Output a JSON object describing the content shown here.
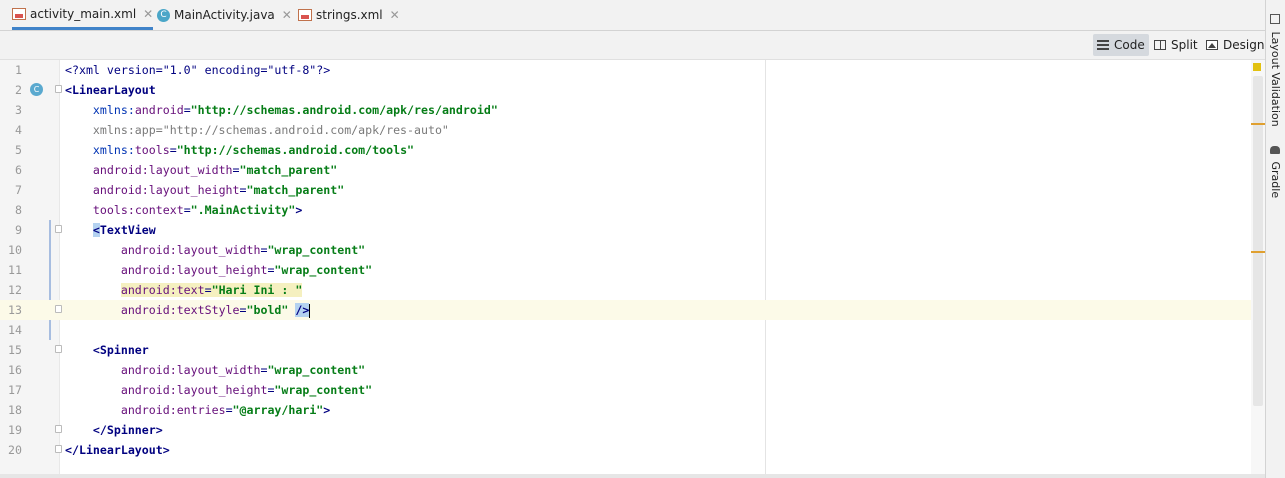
{
  "tabs": [
    {
      "label": "activity_main.xml",
      "icon": "xml-file-icon",
      "active": true
    },
    {
      "label": "MainActivity.java",
      "icon": "java-class-icon",
      "active": false
    },
    {
      "label": "strings.xml",
      "icon": "xml-file-icon",
      "active": false
    }
  ],
  "view_modes": [
    {
      "label": "Code",
      "icon": "code-view-icon",
      "selected": true
    },
    {
      "label": "Split",
      "icon": "split-view-icon",
      "selected": false
    },
    {
      "label": "Design",
      "icon": "design-view-icon",
      "selected": false
    }
  ],
  "right_panel": {
    "layout_validation": "Layout Validation",
    "gradle": "Gradle"
  },
  "gutter_badge": "C",
  "colors": {
    "tag": "#000080",
    "attribute": "#660e7a",
    "value": "#067d17",
    "current_line": "#fcfae8",
    "selection": "#b4d2f0",
    "active_tab_underline": "#4083c9"
  },
  "editor": {
    "lines": [
      {
        "n": "1",
        "indent": "",
        "tokens": [
          {
            "t": "<?xml version=\"1.0\" encoding=\"utf-8\"?>",
            "c": "tagb"
          }
        ]
      },
      {
        "n": "2",
        "indent": "",
        "tokens": [
          {
            "t": "<LinearLayout",
            "c": "tag"
          }
        ]
      },
      {
        "n": "3",
        "indent": "    ",
        "tokens": [
          {
            "t": "xmlns:",
            "c": "ns"
          },
          {
            "t": "android",
            "c": "attr"
          },
          {
            "t": "=",
            "c": "tagb"
          },
          {
            "t": "\"http://schemas.android.com/apk/res/android\"",
            "c": "val"
          }
        ]
      },
      {
        "n": "4",
        "indent": "    ",
        "tokens": [
          {
            "t": "xmlns:app=\"http://schemas.android.com/apk/res-auto\"",
            "c": "gray"
          }
        ]
      },
      {
        "n": "5",
        "indent": "    ",
        "tokens": [
          {
            "t": "xmlns:",
            "c": "ns"
          },
          {
            "t": "tools",
            "c": "attr"
          },
          {
            "t": "=",
            "c": "tagb"
          },
          {
            "t": "\"http://schemas.android.com/tools\"",
            "c": "val"
          }
        ]
      },
      {
        "n": "6",
        "indent": "    ",
        "tokens": [
          {
            "t": "android:",
            "c": "attr"
          },
          {
            "t": "layout_width",
            "c": "attr"
          },
          {
            "t": "=",
            "c": "tagb"
          },
          {
            "t": "\"match_parent\"",
            "c": "val"
          }
        ]
      },
      {
        "n": "7",
        "indent": "    ",
        "tokens": [
          {
            "t": "android:",
            "c": "attr"
          },
          {
            "t": "layout_height",
            "c": "attr"
          },
          {
            "t": "=",
            "c": "tagb"
          },
          {
            "t": "\"match_parent\"",
            "c": "val"
          }
        ]
      },
      {
        "n": "8",
        "indent": "    ",
        "tokens": [
          {
            "t": "tools:",
            "c": "attr"
          },
          {
            "t": "context",
            "c": "attr"
          },
          {
            "t": "=",
            "c": "tagb"
          },
          {
            "t": "\".MainActivity\"",
            "c": "val"
          },
          {
            "t": ">",
            "c": "tag"
          }
        ]
      },
      {
        "n": "9",
        "indent": "    ",
        "tokens": [
          {
            "t": "<",
            "c": "tag sel-bg"
          },
          {
            "t": "TextView",
            "c": "tag"
          }
        ]
      },
      {
        "n": "10",
        "indent": "        ",
        "tokens": [
          {
            "t": "android:",
            "c": "attr"
          },
          {
            "t": "layout_width",
            "c": "attr"
          },
          {
            "t": "=",
            "c": "tagb"
          },
          {
            "t": "\"wrap_content\"",
            "c": "val"
          }
        ]
      },
      {
        "n": "11",
        "indent": "        ",
        "tokens": [
          {
            "t": "android:",
            "c": "attr"
          },
          {
            "t": "layout_height",
            "c": "attr"
          },
          {
            "t": "=",
            "c": "tagb"
          },
          {
            "t": "\"wrap_content\"",
            "c": "val"
          }
        ]
      },
      {
        "n": "12",
        "indent": "        ",
        "tokens": [
          {
            "t": "android:",
            "c": "attr hl-attr"
          },
          {
            "t": "text",
            "c": "attr hl-attr"
          },
          {
            "t": "=",
            "c": "tagb hl-attr"
          },
          {
            "t": "\"Hari Ini : \"",
            "c": "val hl-attr"
          }
        ]
      },
      {
        "n": "13",
        "indent": "        ",
        "tokens": [
          {
            "t": "android:",
            "c": "attr"
          },
          {
            "t": "textStyle",
            "c": "attr"
          },
          {
            "t": "=",
            "c": "tagb"
          },
          {
            "t": "\"bold\"",
            "c": "val"
          },
          {
            "t": " ",
            "c": "tagb"
          },
          {
            "t": "/>",
            "c": "tag sel-bg"
          }
        ],
        "current": true
      },
      {
        "n": "14",
        "indent": "",
        "tokens": []
      },
      {
        "n": "15",
        "indent": "    ",
        "tokens": [
          {
            "t": "<Spinner",
            "c": "tag"
          }
        ]
      },
      {
        "n": "16",
        "indent": "        ",
        "tokens": [
          {
            "t": "android:",
            "c": "attr"
          },
          {
            "t": "layout_width",
            "c": "attr"
          },
          {
            "t": "=",
            "c": "tagb"
          },
          {
            "t": "\"wrap_content\"",
            "c": "val"
          }
        ]
      },
      {
        "n": "17",
        "indent": "        ",
        "tokens": [
          {
            "t": "android:",
            "c": "attr"
          },
          {
            "t": "layout_height",
            "c": "attr"
          },
          {
            "t": "=",
            "c": "tagb"
          },
          {
            "t": "\"wrap_content\"",
            "c": "val"
          }
        ]
      },
      {
        "n": "18",
        "indent": "        ",
        "tokens": [
          {
            "t": "android:",
            "c": "attr"
          },
          {
            "t": "entries",
            "c": "attr"
          },
          {
            "t": "=",
            "c": "tagb"
          },
          {
            "t": "\"@array/hari\"",
            "c": "val"
          },
          {
            "t": ">",
            "c": "tag"
          }
        ]
      },
      {
        "n": "19",
        "indent": "    ",
        "tokens": [
          {
            "t": "</Spinner>",
            "c": "tag"
          }
        ]
      },
      {
        "n": "20",
        "indent": "",
        "tokens": [
          {
            "t": "</LinearLayout>",
            "c": "tag"
          }
        ]
      }
    ]
  }
}
